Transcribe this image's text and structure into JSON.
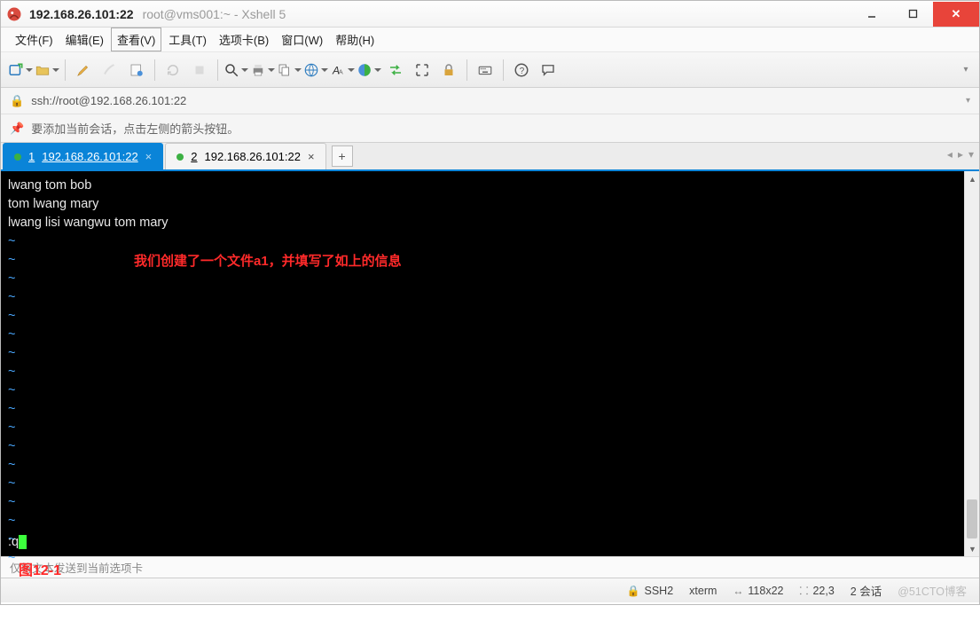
{
  "window": {
    "title_main": "192.168.26.101:22",
    "title_sub": "root@vms001:~ - Xshell 5"
  },
  "menu": {
    "file": "文件(F)",
    "edit": "编辑(E)",
    "view": "查看(V)",
    "tools": "工具(T)",
    "tabs": "选项卡(B)",
    "window": "窗口(W)",
    "help": "帮助(H)"
  },
  "address": {
    "url": "ssh://root@192.168.26.101:22"
  },
  "infobar": {
    "text": "要添加当前会话，点击左侧的箭头按钮。"
  },
  "tabs": [
    {
      "idx": "1",
      "label": "192.168.26.101:22",
      "active": true
    },
    {
      "idx": "2",
      "label": "192.168.26.101:22",
      "active": false
    }
  ],
  "terminal": {
    "lines": [
      "lwang tom bob",
      "tom lwang mary",
      "lwang lisi wangwu tom mary"
    ],
    "annotation": "我们创建了一个文件a1，并填写了如上的信息",
    "prompt": ":q"
  },
  "hint": "仅将文本发送到当前选项卡",
  "figure_label": "图12-1",
  "status": {
    "proto": "SSH2",
    "term": "xterm",
    "size": "118x22",
    "cursor": "22,3",
    "sessions": "2 会话"
  },
  "watermark": "@51CTO博客",
  "icons": {
    "new": "new-session-icon",
    "open": "open-icon",
    "copy": "copy-icon",
    "paste": "paste-icon",
    "props": "properties-icon",
    "search": "search-icon",
    "print": "print-icon",
    "copysel": "copy-selection-icon",
    "globe": "globe-icon",
    "font": "font-icon",
    "colors": "color-scheme-icon",
    "arrows": "transfer-icon",
    "full": "fullscreen-icon",
    "lock": "lock-icon",
    "keyb": "keyboard-icon",
    "help": "help-icon",
    "chat": "chat-icon"
  }
}
